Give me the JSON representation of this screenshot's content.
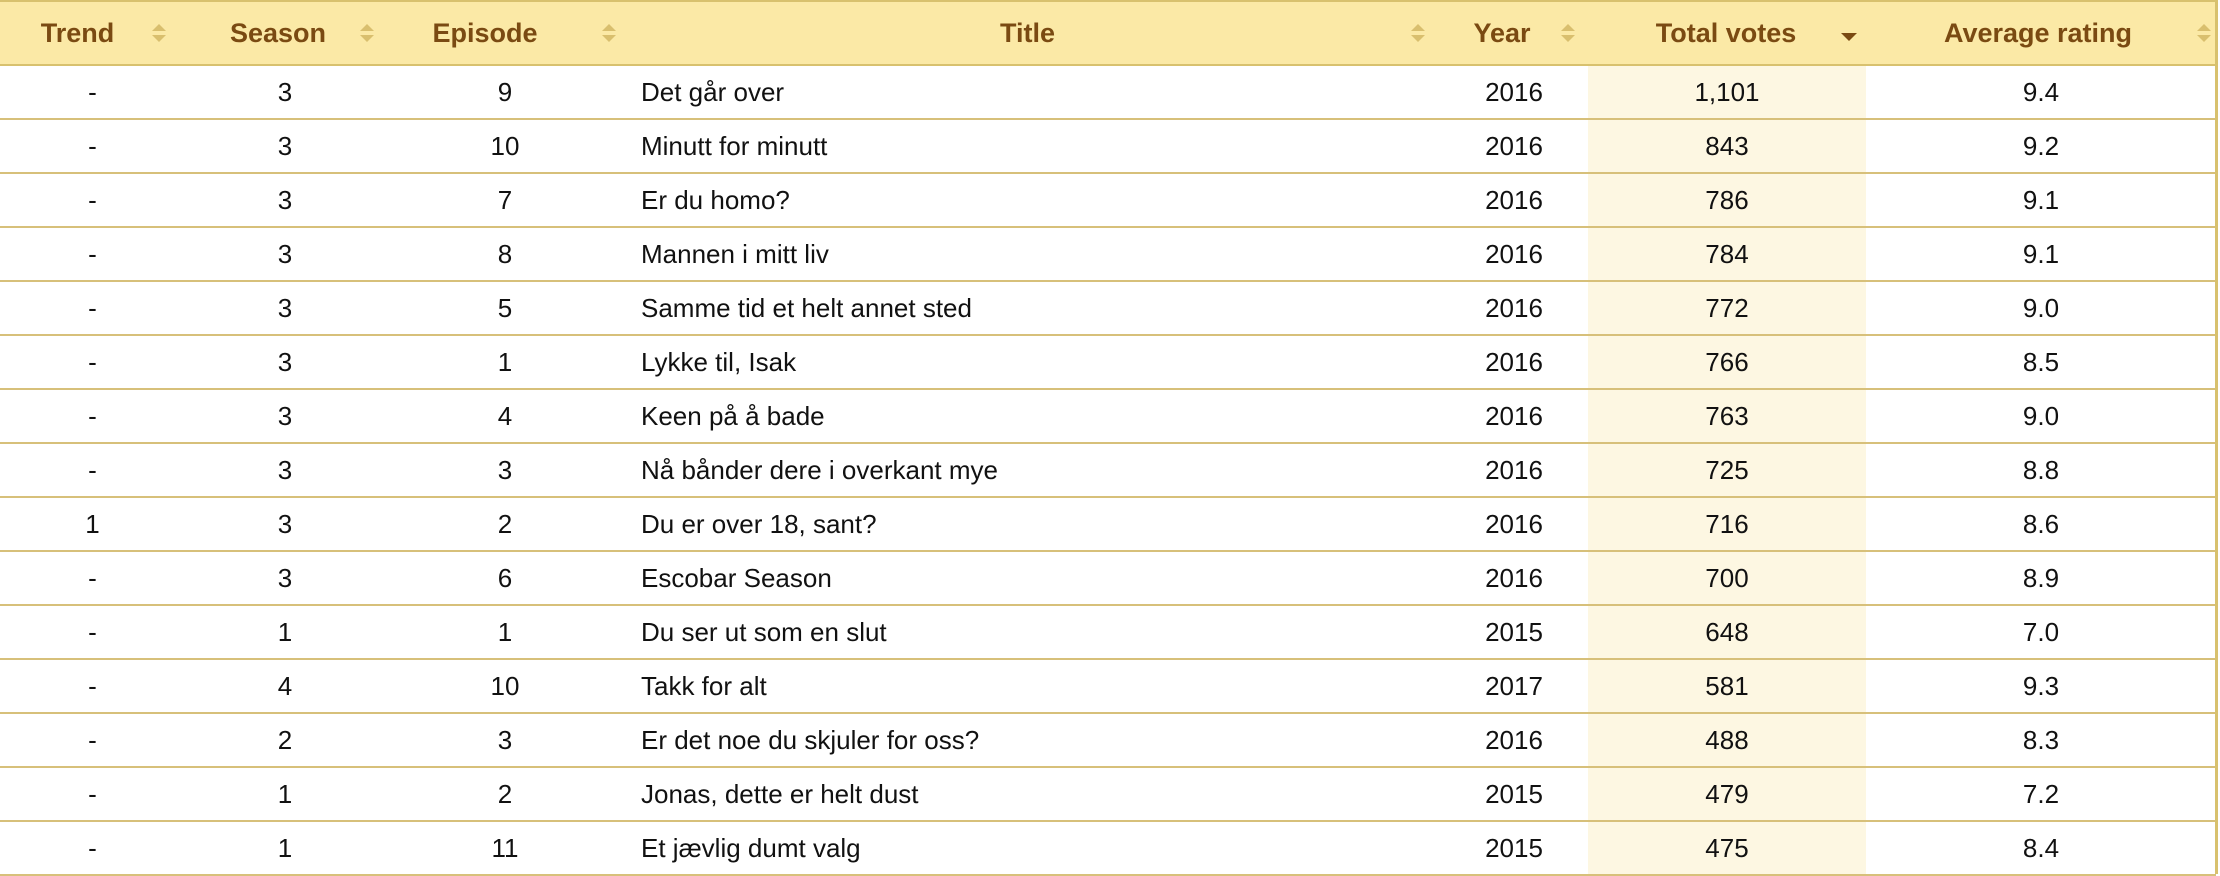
{
  "columns": {
    "trend": "Trend",
    "season": "Season",
    "episode": "Episode",
    "title": "Title",
    "year": "Year",
    "total_votes": "Total votes",
    "average_rating": "Average rating"
  },
  "sort": {
    "column": "Total votes",
    "direction": "descending"
  },
  "colors": {
    "header_bg": "#fbe9a6",
    "header_text": "#7a4a12",
    "row_border": "#d7c07a",
    "sorted_col_bg": "#fdf7e2"
  },
  "rows": [
    {
      "trend": "-",
      "season": "3",
      "episode": "9",
      "title": "Det går over",
      "year": "2016",
      "votes": "1,101",
      "rating": "9.4"
    },
    {
      "trend": "-",
      "season": "3",
      "episode": "10",
      "title": "Minutt for minutt",
      "year": "2016",
      "votes": "843",
      "rating": "9.2"
    },
    {
      "trend": "-",
      "season": "3",
      "episode": "7",
      "title": "Er du homo?",
      "year": "2016",
      "votes": "786",
      "rating": "9.1"
    },
    {
      "trend": "-",
      "season": "3",
      "episode": "8",
      "title": "Mannen i mitt liv",
      "year": "2016",
      "votes": "784",
      "rating": "9.1"
    },
    {
      "trend": "-",
      "season": "3",
      "episode": "5",
      "title": "Samme tid et helt annet sted",
      "year": "2016",
      "votes": "772",
      "rating": "9.0"
    },
    {
      "trend": "-",
      "season": "3",
      "episode": "1",
      "title": "Lykke til, Isak",
      "year": "2016",
      "votes": "766",
      "rating": "8.5"
    },
    {
      "trend": "-",
      "season": "3",
      "episode": "4",
      "title": "Keen på å bade",
      "year": "2016",
      "votes": "763",
      "rating": "9.0"
    },
    {
      "trend": "-",
      "season": "3",
      "episode": "3",
      "title": "Nå bånder dere i overkant mye",
      "year": "2016",
      "votes": "725",
      "rating": "8.8"
    },
    {
      "trend": "1",
      "season": "3",
      "episode": "2",
      "title": "Du er over 18, sant?",
      "year": "2016",
      "votes": "716",
      "rating": "8.6"
    },
    {
      "trend": "-",
      "season": "3",
      "episode": "6",
      "title": "Escobar Season",
      "year": "2016",
      "votes": "700",
      "rating": "8.9"
    },
    {
      "trend": "-",
      "season": "1",
      "episode": "1",
      "title": "Du ser ut som en slut",
      "year": "2015",
      "votes": "648",
      "rating": "7.0"
    },
    {
      "trend": "-",
      "season": "4",
      "episode": "10",
      "title": "Takk for alt",
      "year": "2017",
      "votes": "581",
      "rating": "9.3"
    },
    {
      "trend": "-",
      "season": "2",
      "episode": "3",
      "title": "Er det noe du skjuler for oss?",
      "year": "2016",
      "votes": "488",
      "rating": "8.3"
    },
    {
      "trend": "-",
      "season": "1",
      "episode": "2",
      "title": "Jonas, dette er helt dust",
      "year": "2015",
      "votes": "479",
      "rating": "7.2"
    },
    {
      "trend": "-",
      "season": "1",
      "episode": "11",
      "title": "Et jævlig dumt valg",
      "year": "2015",
      "votes": "475",
      "rating": "8.4"
    }
  ]
}
